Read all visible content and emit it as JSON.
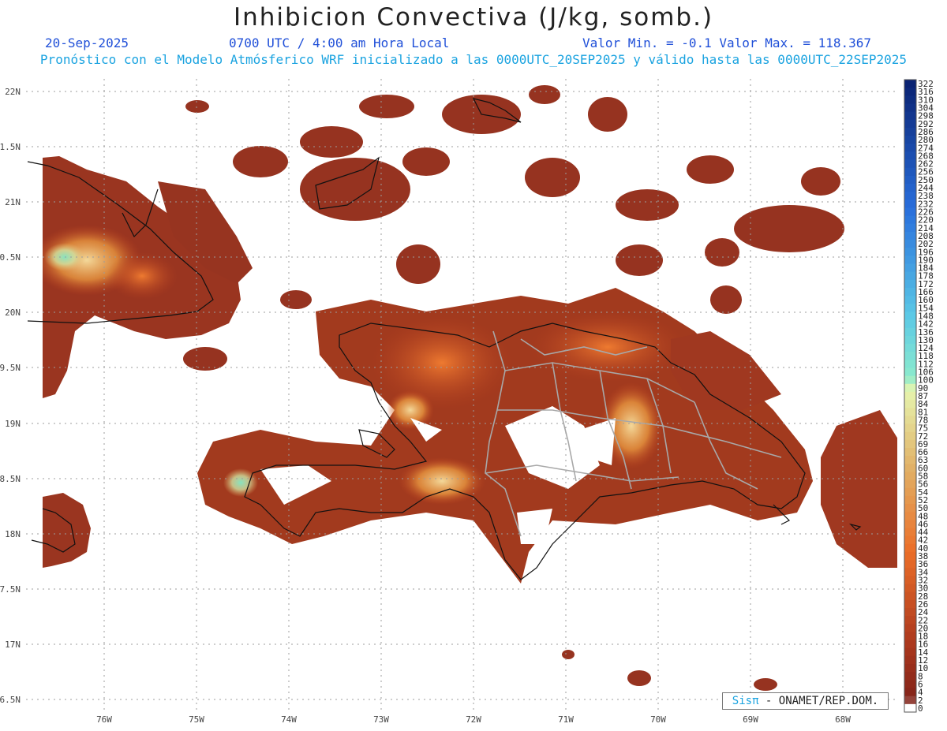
{
  "header": {
    "title": "Inhibicion Convectiva (J/kg, somb.)",
    "date": "20-Sep-2025",
    "time": "0700 UTC / 4:00 am Hora Local",
    "minmax": "Valor Min. = -0.1  Valor Max. = 118.367",
    "model_info": "Pronóstico con el Modelo Atmósferico WRF inicializado a las 0000UTC_20SEP2025 y válido hasta las  0000UTC_22SEP2025"
  },
  "map": {
    "lat_labels": [
      "22N",
      "21.5N",
      "21N",
      "20.5N",
      "20N",
      "19.5N",
      "19N",
      "18.5N",
      "18N",
      "17.5N",
      "17N",
      "16.5N"
    ],
    "lon_labels": [
      "76W",
      "75W",
      "74W",
      "73W",
      "72W",
      "71W",
      "70W",
      "69W",
      "68W"
    ],
    "colors": {
      "land_low": "#8a2f1e",
      "mid": "#e0612a",
      "high": "#e9b870",
      "peak": "#7fe0b8",
      "coast": "#111111",
      "borders": "#a8a8a8"
    }
  },
  "legend": {
    "labels": [
      "322",
      "316",
      "310",
      "304",
      "298",
      "292",
      "286",
      "280",
      "274",
      "268",
      "262",
      "256",
      "250",
      "244",
      "238",
      "232",
      "226",
      "220",
      "214",
      "208",
      "202",
      "196",
      "190",
      "184",
      "178",
      "172",
      "166",
      "160",
      "154",
      "148",
      "142",
      "136",
      "130",
      "124",
      "118",
      "112",
      "106",
      "100",
      "90",
      "87",
      "84",
      "81",
      "78",
      "75",
      "72",
      "69",
      "66",
      "63",
      "60",
      "58",
      "56",
      "54",
      "52",
      "50",
      "48",
      "46",
      "44",
      "42",
      "40",
      "38",
      "36",
      "34",
      "32",
      "30",
      "28",
      "26",
      "24",
      "22",
      "20",
      "18",
      "16",
      "14",
      "12",
      "10",
      "8",
      "6",
      "4",
      "2",
      "0"
    ]
  },
  "credit": {
    "sis": "Sisπ",
    "rest": " - ONAMET/REP.DOM."
  }
}
